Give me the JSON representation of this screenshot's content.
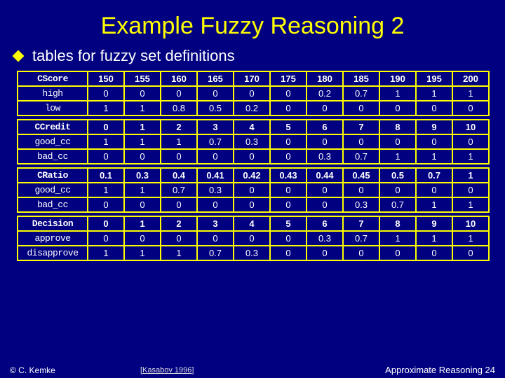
{
  "title": "Example Fuzzy Reasoning 2",
  "bullet": "tables for fuzzy set definitions",
  "tables": [
    {
      "header": [
        "CScore",
        "150",
        "155",
        "160",
        "165",
        "170",
        "175",
        "180",
        "185",
        "190",
        "195",
        "200"
      ],
      "rows": [
        [
          "high",
          "0",
          "0",
          "0",
          "0",
          "0",
          "0",
          "0.2",
          "0.7",
          "1",
          "1",
          "1"
        ],
        [
          "low",
          "1",
          "1",
          "0.8",
          "0.5",
          "0.2",
          "0",
          "0",
          "0",
          "0",
          "0",
          "0"
        ]
      ]
    },
    {
      "header": [
        "CCredit",
        "0",
        "1",
        "2",
        "3",
        "4",
        "5",
        "6",
        "7",
        "8",
        "9",
        "10"
      ],
      "rows": [
        [
          "good_cc",
          "1",
          "1",
          "1",
          "0.7",
          "0.3",
          "0",
          "0",
          "0",
          "0",
          "0",
          "0"
        ],
        [
          "bad_cc",
          "0",
          "0",
          "0",
          "0",
          "0",
          "0",
          "0.3",
          "0.7",
          "1",
          "1",
          "1"
        ]
      ]
    },
    {
      "header": [
        "CRatio",
        "0.1",
        "0.3",
        "0.4",
        "0.41",
        "0.42",
        "0.43",
        "0.44",
        "0.45",
        "0.5",
        "0.7",
        "1"
      ],
      "rows": [
        [
          "good_cc",
          "1",
          "1",
          "0.7",
          "0.3",
          "0",
          "0",
          "0",
          "0",
          "0",
          "0",
          "0"
        ],
        [
          "bad_cc",
          "0",
          "0",
          "0",
          "0",
          "0",
          "0",
          "0",
          "0.3",
          "0.7",
          "1",
          "1"
        ]
      ]
    },
    {
      "header": [
        "Decision",
        "0",
        "1",
        "2",
        "3",
        "4",
        "5",
        "6",
        "7",
        "8",
        "9",
        "10"
      ],
      "rows": [
        [
          "approve",
          "0",
          "0",
          "0",
          "0",
          "0",
          "0",
          "0.3",
          "0.7",
          "1",
          "1",
          "1"
        ],
        [
          "disapprove",
          "1",
          "1",
          "1",
          "0.7",
          "0.3",
          "0",
          "0",
          "0",
          "0",
          "0",
          "0"
        ]
      ]
    }
  ],
  "footer": {
    "left": "© C. Kemke",
    "cite": "[Kasabov 1996]",
    "right": "Approximate Reasoning 24"
  }
}
